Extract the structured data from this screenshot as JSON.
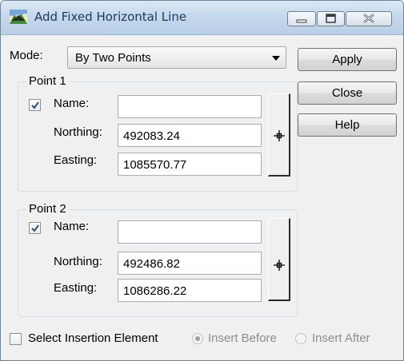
{
  "window": {
    "title": "Add Fixed Horizontal Line",
    "icon_name": "app-icon",
    "buttons": {
      "minimize": "minimize-icon",
      "maximize": "maximize-icon",
      "close": "close-icon"
    }
  },
  "mode": {
    "label": "Mode:",
    "selected": "By Two Points"
  },
  "actions": {
    "apply": "Apply",
    "close": "Close",
    "help": "Help"
  },
  "point1": {
    "title": "Point 1",
    "name_checked": true,
    "name_label": "Name:",
    "name_value": "",
    "northing_label": "Northing:",
    "northing_value": "492083.24",
    "easting_label": "Easting:",
    "easting_value": "1085570.77"
  },
  "point2": {
    "title": "Point 2",
    "name_checked": true,
    "name_label": "Name:",
    "name_value": "",
    "northing_label": "Northing:",
    "northing_value": "492486.82",
    "easting_label": "Easting:",
    "easting_value": "1086286.22"
  },
  "insertion": {
    "select_label": "Select Insertion Element",
    "select_checked": false,
    "insert_before": "Insert Before",
    "insert_before_selected": true,
    "insert_after": "Insert After",
    "insert_after_selected": false,
    "disabled": true
  },
  "colors": {
    "title_text": "#1e395b",
    "dialog_bg": "#f0f0f0",
    "check_mark": "#2b4e7d"
  }
}
